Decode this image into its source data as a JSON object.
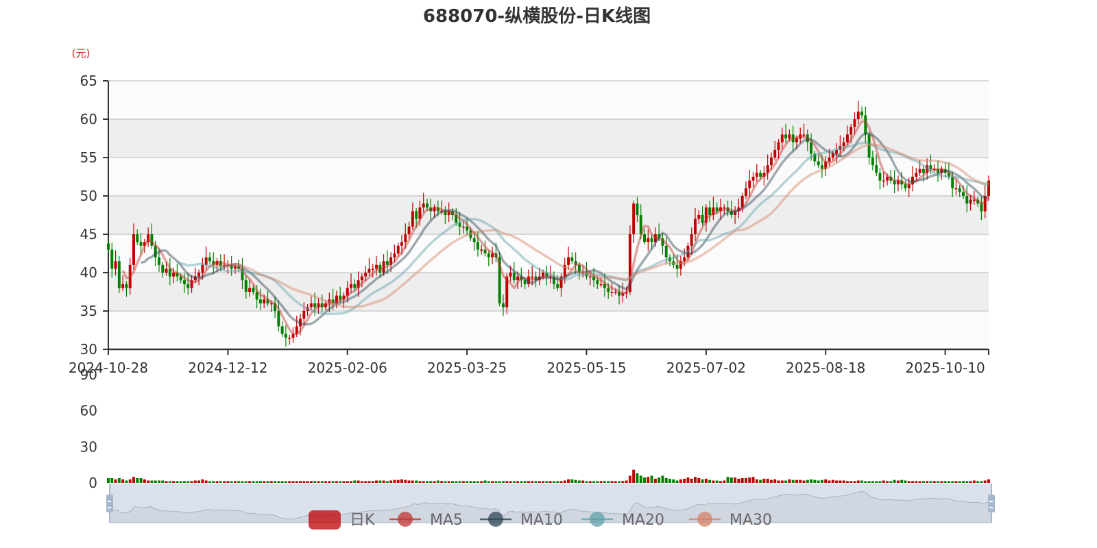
{
  "chart_data": {
    "type": "candlestick",
    "title": "688070-纵横股份-日K线图",
    "ylabel": "(元)",
    "ylim": [
      30,
      65
    ],
    "yticks": [
      30,
      35,
      40,
      45,
      50,
      55,
      60,
      65
    ],
    "volume_ylim": [
      0,
      90
    ],
    "volume_yticks": [
      0,
      30,
      60,
      90
    ],
    "xtick_labels": [
      "2024-10-28",
      "2024-12-12",
      "2025-02-06",
      "2025-03-25",
      "2025-05-15",
      "2025-07-02",
      "2025-08-18",
      "2025-10-10"
    ],
    "xtick_interval": 33,
    "legend": [
      "日K",
      "MA5",
      "MA10",
      "MA20",
      "MA30"
    ],
    "legend_position": "bottom",
    "colors": {
      "up": "#c00000",
      "down": "#008000",
      "ma5": "#c23531",
      "ma10": "#2f4554",
      "ma20": "#61a0a8",
      "ma30": "#d48265",
      "slider": "#d5dce6"
    },
    "close": [
      43,
      40.5,
      41.5,
      38,
      38.5,
      38,
      41,
      45,
      44,
      43.5,
      44,
      45,
      43.5,
      42,
      41,
      40,
      40.5,
      39.5,
      40,
      39.5,
      39,
      38.5,
      38,
      39,
      39.5,
      40,
      41,
      42,
      41.5,
      41,
      41.5,
      40.8,
      41,
      41,
      40.5,
      40.8,
      40.5,
      39,
      37.5,
      38,
      37.5,
      36.5,
      36,
      36.5,
      36,
      36,
      35,
      33,
      32,
      31.5,
      31.5,
      32,
      33,
      34,
      35,
      35.5,
      36,
      35.5,
      36,
      35.5,
      36,
      36.5,
      36,
      37,
      36.5,
      37,
      38,
      38.5,
      38,
      39,
      39.5,
      40,
      40.5,
      40.5,
      41,
      40,
      41.5,
      41,
      42,
      42.5,
      43.5,
      44,
      45,
      46,
      48,
      47,
      48.5,
      49,
      48.5,
      48,
      48.5,
      48,
      48,
      47.5,
      48,
      47.5,
      46.5,
      46,
      46,
      45.5,
      44.5,
      44,
      43,
      43,
      42.5,
      42,
      42.5,
      42,
      36,
      35.5,
      39.5,
      40,
      39,
      39.5,
      39,
      38.5,
      39.5,
      39.5,
      39,
      39.5,
      40,
      39.5,
      39.5,
      38.5,
      38,
      39.5,
      41,
      42,
      41.5,
      41,
      40,
      40,
      39.5,
      39.5,
      39,
      38.5,
      38.5,
      38,
      37.5,
      37.5,
      37.5,
      37,
      37.3,
      37.5,
      45,
      49,
      47.5,
      45,
      44,
      44.5,
      44,
      45,
      44.5,
      43.5,
      42,
      41.5,
      41,
      40.5,
      41.5,
      42,
      43.5,
      45,
      47,
      47.5,
      46.5,
      48.5,
      47.5,
      48.5,
      48,
      48.5,
      48.5,
      48,
      47.5,
      48,
      48.5,
      50,
      51,
      52,
      52.5,
      53,
      52.5,
      53,
      54,
      55,
      56,
      57,
      58,
      57.5,
      58,
      57,
      57.5,
      58,
      58,
      57,
      55.5,
      54.5,
      54,
      53.5,
      54.5,
      55,
      55.5,
      56,
      56.5,
      57,
      58,
      59,
      60,
      61,
      60.5,
      58,
      55,
      54,
      53,
      52,
      52,
      52.5,
      52,
      51.5,
      52,
      51.5,
      51,
      51.5,
      52.5,
      53,
      53.5,
      53,
      54,
      53.5,
      53.5,
      53,
      53.5,
      53,
      52.5,
      51,
      51,
      50.5,
      50,
      49,
      49.5,
      49.5,
      49,
      48,
      50,
      52
    ],
    "volume": [
      4,
      4,
      3,
      4,
      3,
      2,
      3,
      5,
      4,
      4,
      3,
      2,
      2,
      2,
      2,
      2,
      1.5,
      1.5,
      1.5,
      1.5,
      1.5,
      1.5,
      1.5,
      1.5,
      2,
      2,
      3,
      2,
      1.5,
      1.5,
      1.5,
      1.5,
      1.5,
      1.5,
      1.5,
      1.5,
      1.5,
      1.5,
      1.5,
      1.5,
      1.5,
      1.5,
      1.5,
      1.5,
      1.5,
      1.5,
      1.5,
      1.5,
      1.5,
      1.5,
      1.5,
      1.5,
      1.5,
      1.5,
      1.5,
      1.5,
      1.5,
      1.5,
      1.5,
      1.5,
      1.5,
      1.5,
      1.5,
      1.5,
      1.5,
      1.5,
      1.5,
      1.5,
      2,
      2,
      1.5,
      1.5,
      1.5,
      1.5,
      2,
      2,
      2,
      1.5,
      2,
      2.5,
      2.5,
      3,
      2.5,
      2,
      2,
      2,
      1.5,
      1.5,
      1.5,
      1.5,
      1.5,
      2,
      1.5,
      1.5,
      1.5,
      1.5,
      1.5,
      1.5,
      1.5,
      1.5,
      1.5,
      1.5,
      1.5,
      1.5,
      2,
      1.5,
      1.5,
      1.5,
      1.5,
      1.5,
      1.5,
      1.5,
      1.5,
      1.5,
      1.5,
      1.5,
      1.5,
      1.5,
      1.5,
      1.5,
      1.5,
      1.5,
      1.5,
      1.5,
      1.5,
      1.5,
      2,
      3,
      3,
      2.5,
      2,
      2,
      1.5,
      1.5,
      1.5,
      1.5,
      1.5,
      1.5,
      1.5,
      1.5,
      1.5,
      1.5,
      1.5,
      2,
      6,
      11,
      8,
      6,
      4.5,
      5,
      6,
      3.5,
      4.5,
      6,
      4,
      3.5,
      3,
      2,
      3,
      3.5,
      4.5,
      3.5,
      5,
      4,
      3,
      3.5,
      2.5,
      2,
      2,
      1.5,
      2,
      5,
      4.5,
      4.5,
      3.5,
      4,
      4,
      4.5,
      5,
      3,
      2.5,
      3.5,
      3.5,
      2.5,
      3,
      2,
      2,
      2,
      3,
      2.5,
      2.5,
      2.5,
      2,
      2.5,
      3,
      2.5,
      2,
      2.5,
      3,
      2,
      2.5,
      2,
      2,
      2,
      1.5,
      1.5,
      1.5,
      2,
      2,
      1.5,
      1.5,
      1.5,
      1.5,
      1.5,
      2,
      1.5,
      1.5,
      2.5,
      2,
      2.5,
      2,
      1.5,
      1.5,
      1.5,
      1.5,
      1.5,
      1.5,
      1.5,
      1.5,
      1.5,
      1.5,
      1.5,
      1.5,
      1.5,
      1.5,
      1.5,
      1.5,
      1.5,
      1.5,
      2,
      1.5,
      1.5,
      2,
      3
    ]
  }
}
